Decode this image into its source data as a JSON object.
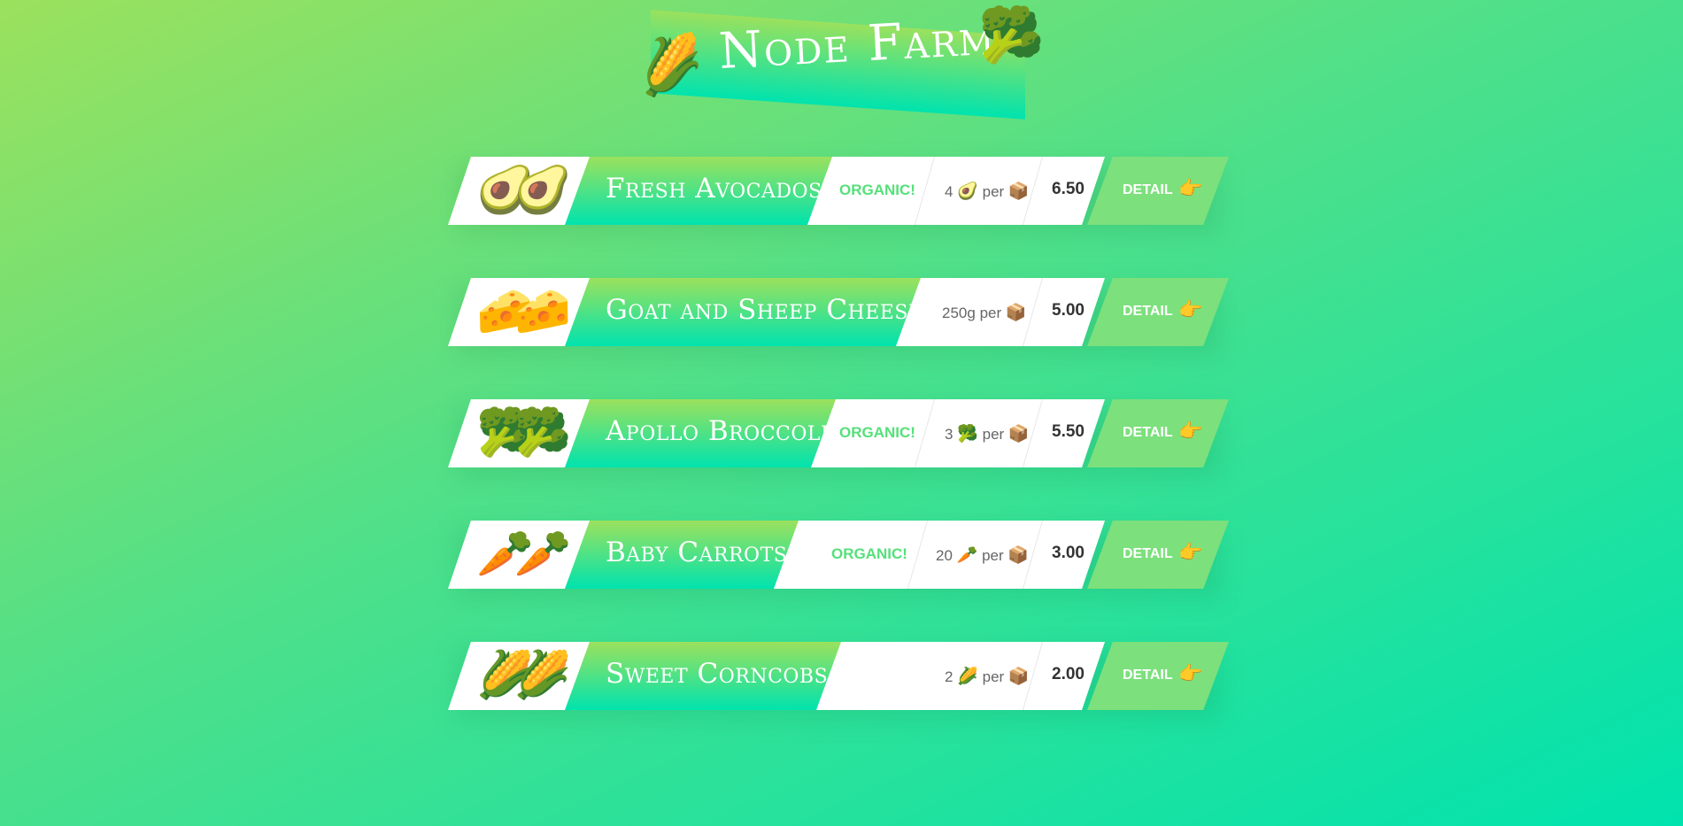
{
  "header": {
    "title": "Node Farm",
    "left_icon": "🌽",
    "right_icon": "🥦"
  },
  "products": [
    {
      "emoji": "🥑🥑",
      "name": "Fresh Avocados",
      "organic": "ORGANIC!",
      "quantity": "4",
      "qty_emoji": "🥑",
      "per": "per",
      "price": "6.50",
      "detail": "DETAIL",
      "detail_icon": "👉"
    },
    {
      "emoji": "🧀🧀",
      "name": "Goat and Sheep Cheese",
      "organic": "",
      "quantity": "250g",
      "qty_emoji": "",
      "per": "per",
      "price": "5.00",
      "detail": "DETAIL",
      "detail_icon": "👉"
    },
    {
      "emoji": "🥦🥦",
      "name": "Apollo Broccoli",
      "organic": "ORGANIC!",
      "quantity": "3",
      "qty_emoji": "🥦",
      "per": "per",
      "price": "5.50",
      "detail": "DETAIL",
      "detail_icon": "👉"
    },
    {
      "emoji": "🥕🥕",
      "name": "Baby Carrots",
      "organic": "ORGANIC!",
      "quantity": "20",
      "qty_emoji": "🥕",
      "per": "per",
      "price": "3.00",
      "detail": "DETAIL",
      "detail_icon": "👉"
    },
    {
      "emoji": "🌽🌽",
      "name": "Sweet Corncobs",
      "organic": "",
      "quantity": "2",
      "qty_emoji": "🌽",
      "per": "per",
      "price": "2.00",
      "detail": "DETAIL",
      "detail_icon": "👉"
    }
  ],
  "box_icon": "📦",
  "colors": {
    "accent_green": "#55e07a",
    "detail_bg": "#7ce07c",
    "gradient_top": "#9be15d",
    "gradient_bottom": "#00e3ae"
  }
}
